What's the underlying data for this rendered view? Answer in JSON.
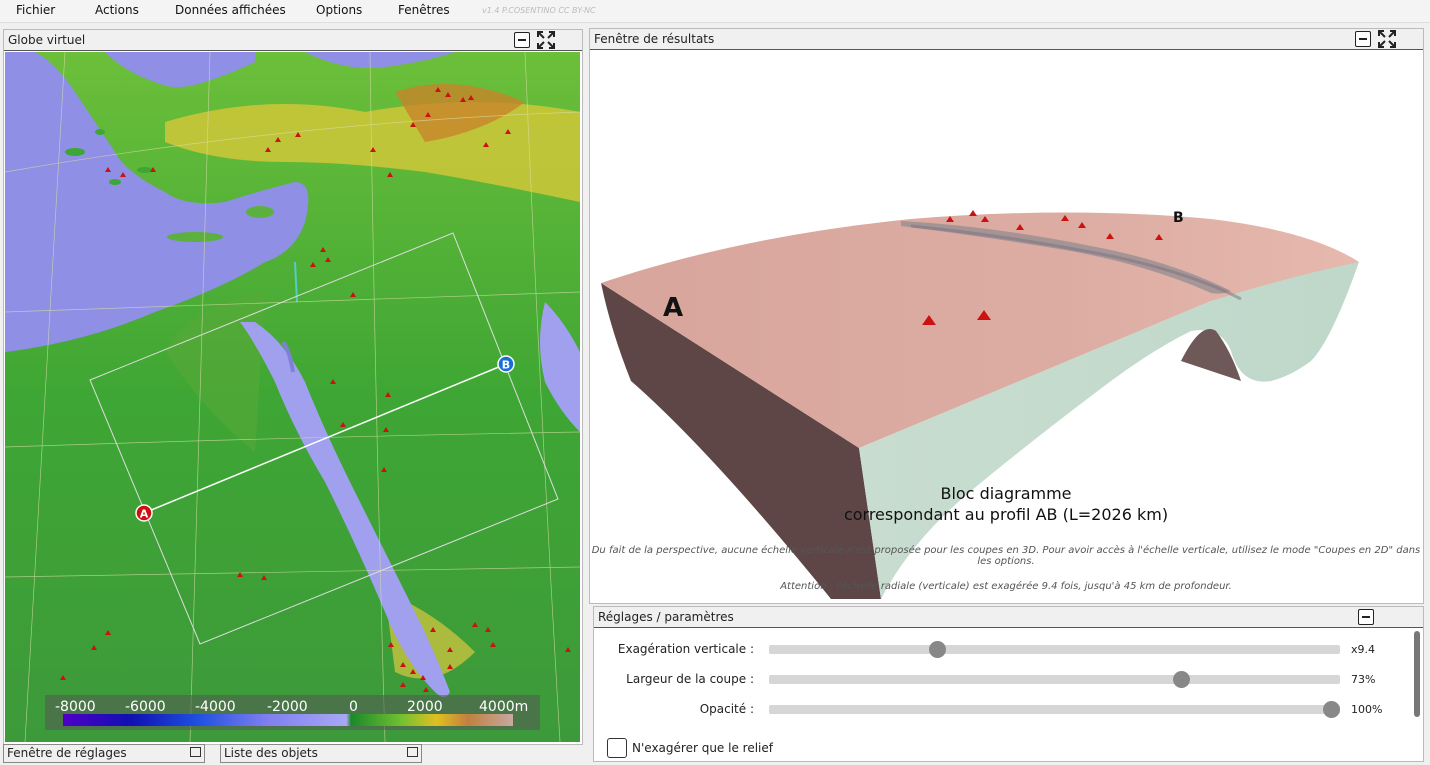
{
  "menu": {
    "items": [
      "Fichier",
      "Actions",
      "Données affichées",
      "Options",
      "Fenêtres"
    ],
    "version": "v1.4 P.COSENTINO CC BY-NC"
  },
  "globe": {
    "title": "Globe virtuel",
    "point_a": "A",
    "point_b": "B",
    "scale_labels": [
      "-8000",
      "-6000",
      "-4000",
      "-2000",
      "0",
      "2000",
      "4000m"
    ]
  },
  "results": {
    "title": "Fenêtre de résultats",
    "label_a": "A",
    "label_b": "B",
    "caption_line1": "Bloc diagramme",
    "caption_line2": "correspondant au profil AB (L=2026 km)",
    "note1": "Du fait de la perspective, aucune échelle verticale n'est proposée pour les coupes en 3D. Pour avoir accès à l'échelle verticale, utilisez le mode \"Coupes en 2D\" dans les options.",
    "note2": "Attention : l'échelle radiale (verticale) est exagérée 9.4 fois, jusqu'à 45 km de profondeur."
  },
  "settings": {
    "title": "Réglages / paramètres",
    "sliders": [
      {
        "label": "Exagération verticale :",
        "value": "x9.4",
        "fraction": 0.295
      },
      {
        "label": "Largeur de la coupe :",
        "value": "73%",
        "fraction": 0.722
      },
      {
        "label": "Opacité :",
        "value": "100%",
        "fraction": 0.985
      }
    ],
    "checkbox_label": "N'exagérer que le relief",
    "checkbox_checked": false
  },
  "bottom_tabs": [
    "Fenêtre de réglages",
    "Liste des objets"
  ],
  "colors": {
    "accent_red": "#cc1111",
    "point_b_blue": "#1a6fd6",
    "sea": "#8f8fe6",
    "land_green": "#3ea634",
    "block_top": "#d8a59c",
    "block_side": "#c8ddd0",
    "block_end": "#5e4646"
  }
}
